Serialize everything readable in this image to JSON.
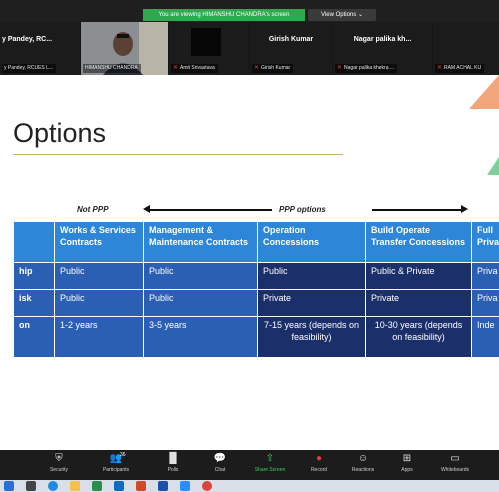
{
  "banner": {
    "viewing_text": "You are viewing HIMANSHU CHANDRA's screen",
    "view_options": "View Options ⌄"
  },
  "participants": [
    {
      "name": "y Pandey, RC...",
      "label": "y Pandey, RCUES L..."
    },
    {
      "name": "",
      "label": "HIMANSHU CHANDRA"
    },
    {
      "name": "",
      "label": "Amit Srivastava"
    },
    {
      "name": "Girish Kumar",
      "label": "Girish Kumar"
    },
    {
      "name": "Nagar palika kh...",
      "label": "Nagar palika khekra ..."
    },
    {
      "name": "",
      "label": "RAM ACHAL KU"
    }
  ],
  "slide": {
    "title": "Options",
    "not_ppp": "Not PPP",
    "ppp_options": "PPP options",
    "table": {
      "headers": [
        "",
        "Works & Services Contracts",
        "Management & Maintenance Contracts",
        "Operation Concessions",
        "Build Operate Transfer Concessions",
        "Full Priva"
      ],
      "rows": [
        {
          "label": "hip",
          "cells": [
            "Public",
            "Public",
            "Public",
            "Public & Private",
            "Priva"
          ]
        },
        {
          "label": "isk",
          "cells": [
            "Public",
            "Public",
            "Private",
            "Private",
            "Priva"
          ]
        },
        {
          "label": "on",
          "cells": [
            "1-2 years",
            "3-5 years",
            "7-15 years (depends on feasibility)",
            "10-30 years (depends on feasibility)",
            "Inde"
          ]
        }
      ]
    }
  },
  "controls": {
    "security": "Security",
    "participants": "Participants",
    "participants_count": "36",
    "polls": "Polls",
    "chat": "Chat",
    "share_screen": "Share Screen",
    "record": "Record",
    "reactions": "Reactions",
    "apps": "Apps",
    "whiteboards": "Whiteboards"
  },
  "colors": {
    "header_blue": "#2e86d9",
    "cell_light": "#2b5fb4",
    "cell_dark": "#1b2f6b",
    "share_green": "#3ecf5e"
  }
}
